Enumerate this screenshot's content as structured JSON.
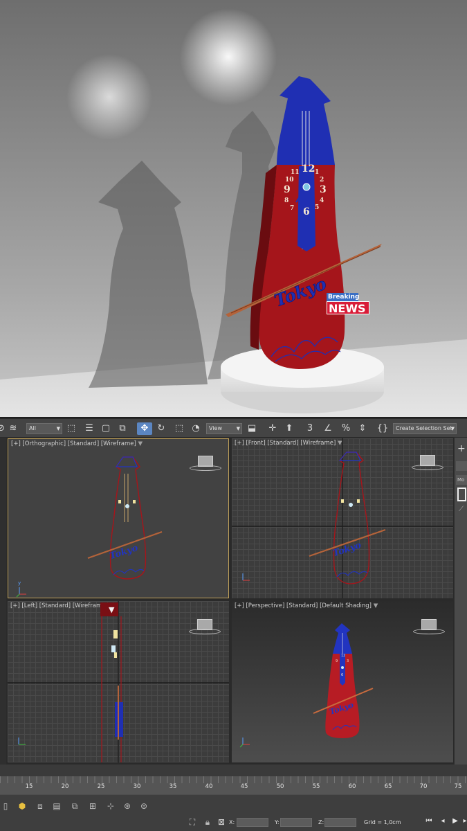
{
  "render": {
    "clock_numbers": [
      "12",
      "1",
      "2",
      "3",
      "4",
      "5",
      "6",
      "7",
      "8",
      "9",
      "10",
      "11"
    ],
    "badge_top": "Breaking",
    "badge_bottom": "NEWS",
    "object_script": "Tokyo"
  },
  "toolbar": {
    "selection_filter": "All",
    "reference_coord": "View",
    "selection_set": "Create Selection Set"
  },
  "viewports": {
    "top_left": {
      "plus": "[+]",
      "view": "[Orthographic]",
      "shading1": "[Standard]",
      "shading2": "[Wireframe]"
    },
    "top_right": {
      "plus": "[+]",
      "view": "[Front]",
      "shading1": "[Standard]",
      "shading2": "[Wireframe]"
    },
    "bottom_left": {
      "plus": "[+]",
      "view": "[Left]",
      "shading1": "[Standard]",
      "shading2": "[Wireframe]"
    },
    "bottom_right": {
      "plus": "[+]",
      "view": "[Perspective]",
      "shading1": "[Standard]",
      "shading2": "[Default Shading]"
    }
  },
  "command_panel": {
    "tab": "Mo"
  },
  "timeline": {
    "ticks": [
      "15",
      "20",
      "25",
      "30",
      "35",
      "40",
      "45",
      "50",
      "55",
      "60",
      "65",
      "70",
      "75"
    ]
  },
  "statusbar": {
    "x_label": "X:",
    "y_label": "Y:",
    "z_label": "Z:",
    "grid_text": "Grid = 1,0cm"
  },
  "colors": {
    "body_red": "#a5151b",
    "head_blue": "#1f2fb3",
    "bow_copper": "#b4633a",
    "active_viewport": "#c0a15a",
    "toolbar_bg": "#444444"
  }
}
